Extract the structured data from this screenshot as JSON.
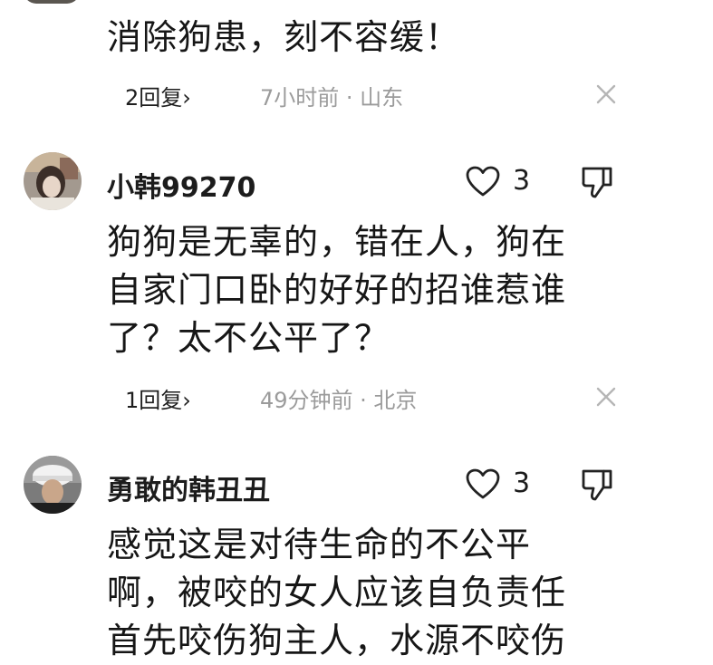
{
  "comments": [
    {
      "text_lines": [
        "消除狗患，刻不容缓！"
      ],
      "replies": "2回复",
      "time_location": "7小时前 · 山东"
    },
    {
      "username": "小韩99270",
      "likes": "3",
      "text_lines": [
        "狗狗是无辜的，错在人，狗在",
        "自家门口卧的好好的招谁惹谁",
        "了？太不公平了？"
      ],
      "replies": "1回复",
      "time_location": "49分钟前 · 北京"
    },
    {
      "username": "勇敢的韩丑丑",
      "likes": "3",
      "text_lines": [
        "感觉这是对待生命的不公平",
        "啊，被咬的女人应该自负责任",
        "首先咬伤狗主人，水源不咬伤"
      ]
    }
  ]
}
